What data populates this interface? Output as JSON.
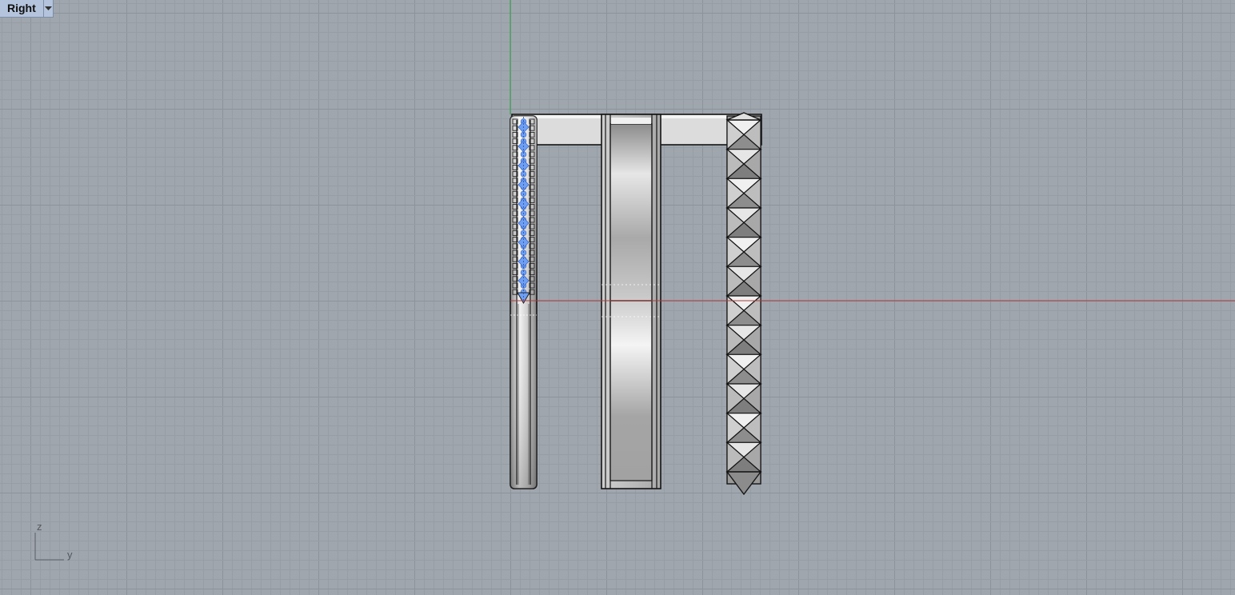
{
  "viewport": {
    "title": "Right",
    "dropdown_icon": "triangle-down-icon"
  },
  "axis_indicator": {
    "vertical_label": "z",
    "horizontal_label": "y"
  },
  "colors": {
    "background": "#a0a6ae",
    "grid_minor": "#979da5",
    "grid_major": "#8d939b",
    "axis_x": "#b23a3a",
    "axis_z": "#2aa044",
    "selection": "#6e9ff2",
    "object_outline": "#141414"
  }
}
